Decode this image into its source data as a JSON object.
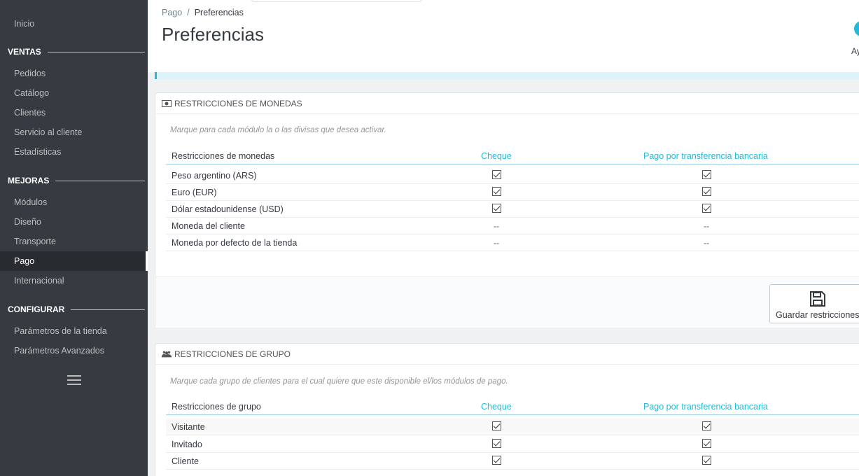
{
  "sidebar": {
    "top_item": "Inicio",
    "sections": [
      {
        "title": "VENTAS",
        "items": [
          "Pedidos",
          "Catálogo",
          "Clientes",
          "Servicio al cliente",
          "Estadísticas"
        ]
      },
      {
        "title": "MEJORAS",
        "items": [
          "Módulos",
          "Diseño",
          "Transporte",
          "Pago",
          "Internacional"
        ]
      },
      {
        "title": "CONFIGURAR",
        "items": [
          "Parámetros de la tienda",
          "Parámetros Avanzados"
        ]
      }
    ],
    "active_item": "Pago"
  },
  "header": {
    "breadcrumb_parent": "Pago",
    "breadcrumb_sep": "/",
    "breadcrumb_current": "Preferencias",
    "title": "Preferencias",
    "help_label": "Ay"
  },
  "currency_panel": {
    "heading": "RESTRICCIONES DE MONEDAS",
    "icon": "money-icon",
    "help_text": "Marque para cada módulo la o las divisas que desea activar.",
    "columns": [
      "Restricciones de monedas",
      "Cheque",
      "Pago por transferencia bancaria"
    ],
    "rows": [
      {
        "label": "Peso argentino (ARS)",
        "cheque": "checked",
        "transfer": "checked"
      },
      {
        "label": "Euro (EUR)",
        "cheque": "checked",
        "transfer": "checked"
      },
      {
        "label": "Dólar estadounidense (USD)",
        "cheque": "checked",
        "transfer": "checked"
      },
      {
        "label": "Moneda del cliente",
        "cheque": "--",
        "transfer": "--"
      },
      {
        "label": "Moneda por defecto de la tienda",
        "cheque": "--",
        "transfer": "--"
      }
    ],
    "save_label": "Guardar restricciones"
  },
  "group_panel": {
    "heading": "RESTRICCIONES DE GRUPO",
    "icon": "users-icon",
    "help_text": "Marque cada grupo de clientes para el cual quiere que este disponible el/los módulos de pago.",
    "columns": [
      "Restricciones de grupo",
      "Cheque",
      "Pago por transferencia bancaria"
    ],
    "rows": [
      {
        "label": "Visitante",
        "cheque": "checked",
        "transfer": "checked"
      },
      {
        "label": "Invitado",
        "cheque": "checked",
        "transfer": "checked"
      },
      {
        "label": "Cliente",
        "cheque": "checked",
        "transfer": "checked"
      }
    ]
  },
  "colors": {
    "sidebar_bg": "#363a41",
    "accent": "#25b9d7",
    "active_item_bg": "#282b30"
  }
}
